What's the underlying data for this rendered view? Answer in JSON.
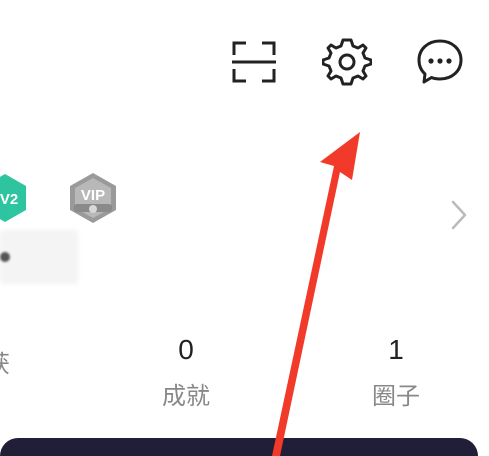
{
  "header": {
    "icons": [
      {
        "name": "scan-icon",
        "color": "#222222"
      },
      {
        "name": "gear-icon",
        "color": "#222222"
      },
      {
        "name": "message-icon",
        "color": "#222222"
      }
    ]
  },
  "profile": {
    "level_badge": {
      "text": "V2",
      "color": "#2ec4a0"
    },
    "vip_badge": {
      "text": "VIP",
      "color": "#9a9a9a"
    }
  },
  "stats": [
    {
      "value": "",
      "label": "获"
    },
    {
      "value": "0",
      "label": "成就"
    },
    {
      "value": "1",
      "label": "圈子"
    }
  ],
  "colors": {
    "annotation_arrow": "#f23a2a",
    "card_background": "#211f38",
    "label_gray": "#888888"
  }
}
